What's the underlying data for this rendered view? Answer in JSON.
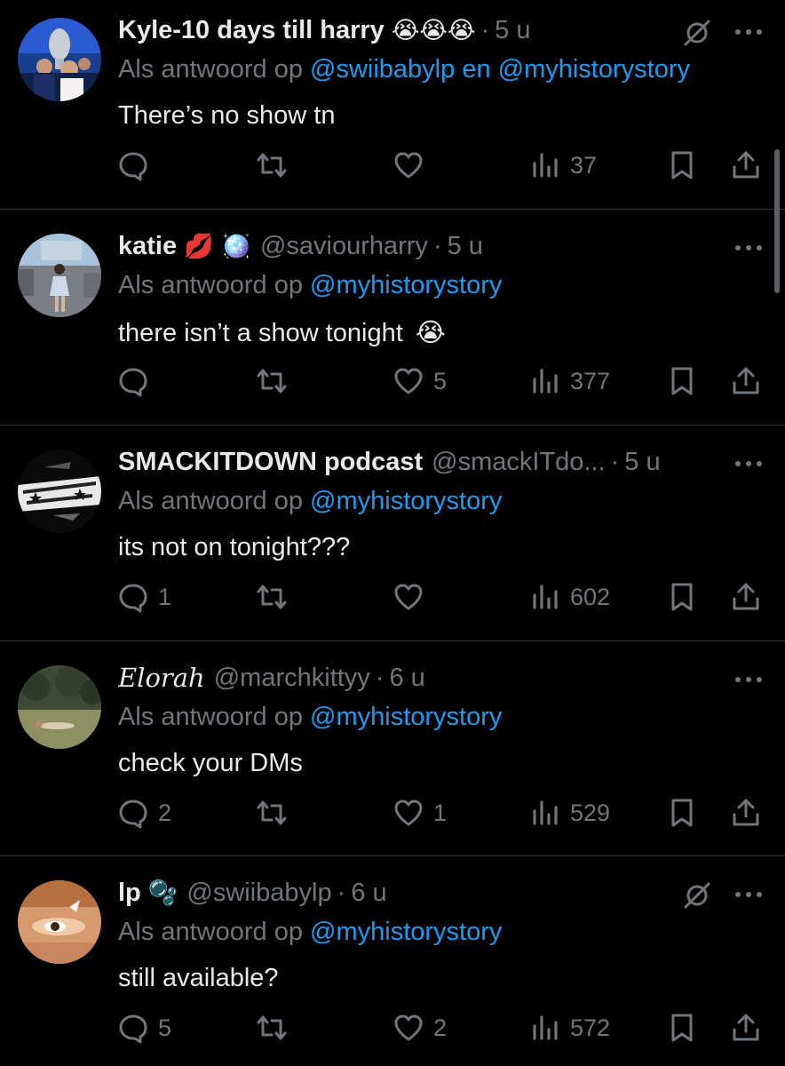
{
  "feed": {
    "tweets": [
      {
        "name": "Kyle-10 days till harry",
        "name_emoji": "😭😭😭",
        "handle": "",
        "time": "5 u",
        "reply_prefix": "Als antwoord op",
        "reply_mentions": "@swiibabylp en @myhistorystory",
        "text": "There’s no show tn",
        "text_emoji": "",
        "replies": "",
        "retweets": "",
        "likes": "",
        "views": "37",
        "muted": true
      },
      {
        "name": "katie",
        "name_emoji": "💋 🪩",
        "handle": "@saviourharry",
        "time": "5 u",
        "reply_prefix": "Als antwoord op",
        "reply_mentions": "@myhistorystory",
        "text": "there isn’t a show tonight",
        "text_emoji": "😭",
        "replies": "",
        "retweets": "",
        "likes": "5",
        "views": "377",
        "muted": false
      },
      {
        "name": "SMACKITDOWN podcast",
        "name_emoji": "",
        "handle": "@smackITdo...",
        "time": "5 u",
        "reply_prefix": "Als antwoord op",
        "reply_mentions": "@myhistorystory",
        "text": "its not on tonight???",
        "text_emoji": "",
        "replies": "1",
        "retweets": "",
        "likes": "",
        "views": "602",
        "muted": false
      },
      {
        "name": "Elorah",
        "name_emoji": "",
        "handle": "@marchkittyy",
        "time": "6 u",
        "reply_prefix": "Als antwoord op",
        "reply_mentions": "@myhistorystory",
        "text": "check your DMs",
        "text_emoji": "",
        "replies": "2",
        "retweets": "",
        "likes": "1",
        "views": "529",
        "muted": false
      },
      {
        "name": "lp",
        "name_emoji": "🫧",
        "handle": "@swiibabylp",
        "time": "6 u",
        "reply_prefix": "Als antwoord op",
        "reply_mentions": "@myhistorystory",
        "text": "still available?",
        "text_emoji": "",
        "replies": "5",
        "retweets": "",
        "likes": "2",
        "views": "572",
        "muted": true
      }
    ],
    "icons": {
      "reply": "reply-icon",
      "retweet": "retweet-icon",
      "like": "heart-icon",
      "views": "views-chart-icon",
      "bookmark": "bookmark-icon",
      "share": "share-icon",
      "more": "more-dots-icon",
      "mute": "muted-icon"
    },
    "colors": {
      "background": "#000000",
      "text": "#e7e9ea",
      "secondary": "#71767b",
      "mention": "#1d9bf0",
      "divider": "#2f3336"
    }
  }
}
